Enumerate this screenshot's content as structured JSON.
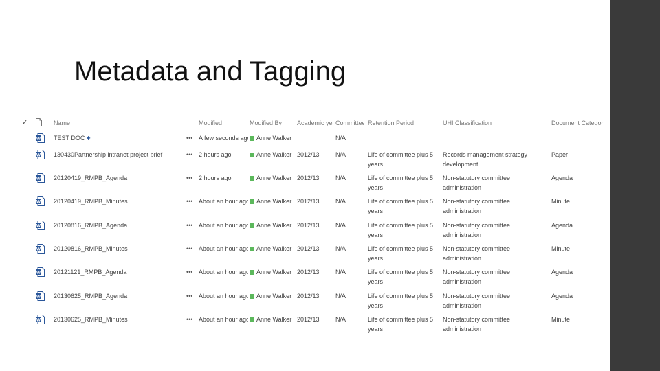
{
  "slide": {
    "title": "Metadata and Tagging"
  },
  "columns": {
    "check": "✓",
    "name": "Name",
    "modified": "Modified",
    "modified_by": "Modified By",
    "academic_year": "Academic year",
    "committee": "Committee",
    "retention": "Retention Period",
    "classification": "UHI Classification",
    "category": "Document Category"
  },
  "colors": {
    "presence": "#5cb85c",
    "sidebar": "#3a3a3a",
    "word_blue": "#2b579a"
  },
  "rows": [
    {
      "name": "TEST DOC",
      "name_icon": "link-icon",
      "dots": "•••",
      "modified": "A few seconds ago",
      "modified_by": "Anne Walker",
      "academic_year": "",
      "committee": "N/A",
      "retention": "",
      "classification": "",
      "category": ""
    },
    {
      "name": "130430Partnership intranet project brief",
      "dots": "•••",
      "modified": "2 hours ago",
      "modified_by": "Anne Walker",
      "academic_year": "2012/13",
      "committee": "N/A",
      "retention": "Life of committee plus 5 years",
      "classification": "Records management strategy development",
      "category": "Paper"
    },
    {
      "name": "20120419_RMPB_Agenda",
      "dots": "•••",
      "modified": "2 hours ago",
      "modified_by": "Anne Walker",
      "academic_year": "2012/13",
      "committee": "N/A",
      "retention": "Life of committee plus 5 years",
      "classification": "Non-statutory committee administration",
      "category": "Agenda"
    },
    {
      "name": "20120419_RMPB_Minutes",
      "dots": "•••",
      "modified": "About an hour ago",
      "modified_by": "Anne Walker",
      "academic_year": "2012/13",
      "committee": "N/A",
      "retention": "Life of committee plus 5 years",
      "classification": "Non-statutory committee administration",
      "category": "Minute"
    },
    {
      "name": "20120816_RMPB_Agenda",
      "dots": "•••",
      "modified": "About an hour ago",
      "modified_by": "Anne Walker",
      "academic_year": "2012/13",
      "committee": "N/A",
      "retention": "Life of committee plus 5 years",
      "classification": "Non-statutory committee administration",
      "category": "Agenda"
    },
    {
      "name": "20120816_RMPB_Minutes",
      "dots": "•••",
      "modified": "About an hour ago",
      "modified_by": "Anne Walker",
      "academic_year": "2012/13",
      "committee": "N/A",
      "retention": "Life of committee plus 5 years",
      "classification": "Non-statutory committee administration",
      "category": "Minute"
    },
    {
      "name": "20121121_RMPB_Agenda",
      "dots": "•••",
      "modified": "About an hour ago",
      "modified_by": "Anne Walker",
      "academic_year": "2012/13",
      "committee": "N/A",
      "retention": "Life of committee plus 5 years",
      "classification": "Non-statutory committee administration",
      "category": "Agenda"
    },
    {
      "name": "20130625_RMPB_Agenda",
      "dots": "•••",
      "modified": "About an hour ago",
      "modified_by": "Anne Walker",
      "academic_year": "2012/13",
      "committee": "N/A",
      "retention": "Life of committee plus 5 years",
      "classification": "Non-statutory committee administration",
      "category": "Agenda"
    },
    {
      "name": "20130625_RMPB_Minutes",
      "dots": "•••",
      "modified": "About an hour ago",
      "modified_by": "Anne Walker",
      "academic_year": "2012/13",
      "committee": "N/A",
      "retention": "Life of committee plus 5 years",
      "classification": "Non-statutory committee administration",
      "category": "Minute"
    }
  ]
}
